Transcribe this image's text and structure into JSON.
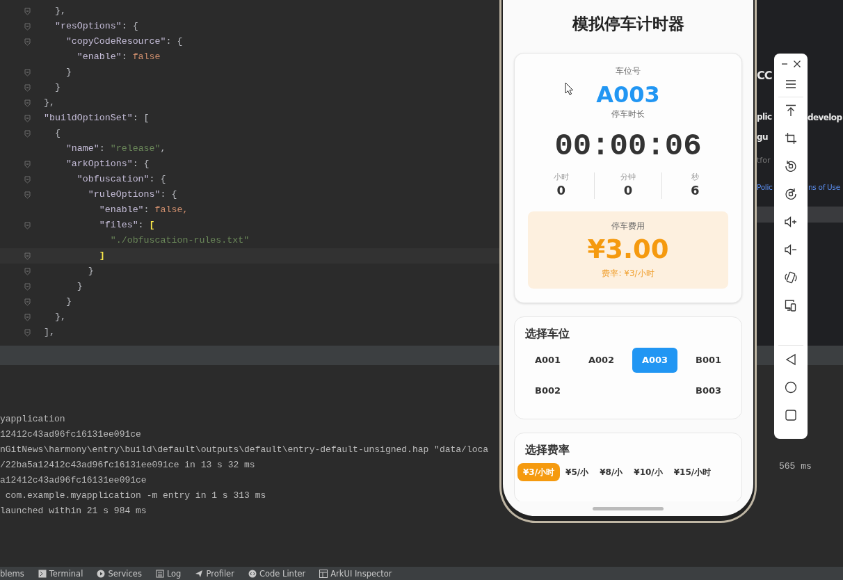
{
  "editor": {
    "lines": [
      {
        "fold": true,
        "current": false,
        "tokens": [
          {
            "kind": "punct",
            "text": "    },"
          }
        ]
      },
      {
        "fold": true,
        "current": false,
        "tokens": [
          {
            "kind": "key",
            "text": "    \"resOptions\""
          },
          {
            "kind": "punct",
            "text": ": {"
          }
        ]
      },
      {
        "fold": true,
        "current": false,
        "tokens": [
          {
            "kind": "key",
            "text": "      \"copyCodeResource\""
          },
          {
            "kind": "punct",
            "text": ": {"
          }
        ]
      },
      {
        "fold": false,
        "current": false,
        "tokens": [
          {
            "kind": "key",
            "text": "        \"enable\""
          },
          {
            "kind": "punct",
            "text": ": "
          },
          {
            "kind": "bool",
            "text": "false"
          }
        ]
      },
      {
        "fold": true,
        "current": false,
        "tokens": [
          {
            "kind": "punct",
            "text": "      }"
          }
        ]
      },
      {
        "fold": true,
        "current": false,
        "tokens": [
          {
            "kind": "punct",
            "text": "    }"
          }
        ]
      },
      {
        "fold": true,
        "current": false,
        "tokens": [
          {
            "kind": "punct",
            "text": "  },"
          }
        ]
      },
      {
        "fold": true,
        "current": false,
        "tokens": [
          {
            "kind": "key",
            "text": "  \"buildOptionSet\""
          },
          {
            "kind": "punct",
            "text": ": ["
          }
        ]
      },
      {
        "fold": true,
        "current": false,
        "tokens": [
          {
            "kind": "punct",
            "text": "    {"
          }
        ]
      },
      {
        "fold": false,
        "current": false,
        "tokens": [
          {
            "kind": "key",
            "text": "      \"name\""
          },
          {
            "kind": "punct",
            "text": ": "
          },
          {
            "kind": "string",
            "text": "\"release\""
          },
          {
            "kind": "punct",
            "text": ","
          }
        ]
      },
      {
        "fold": true,
        "current": false,
        "tokens": [
          {
            "kind": "key",
            "text": "      \"arkOptions\""
          },
          {
            "kind": "punct",
            "text": ": {"
          }
        ]
      },
      {
        "fold": true,
        "current": false,
        "tokens": [
          {
            "kind": "key",
            "text": "        \"obfuscation\""
          },
          {
            "kind": "punct",
            "text": ": {"
          }
        ]
      },
      {
        "fold": true,
        "current": false,
        "tokens": [
          {
            "kind": "key",
            "text": "          \"ruleOptions\""
          },
          {
            "kind": "punct",
            "text": ": {"
          }
        ]
      },
      {
        "fold": false,
        "current": false,
        "tokens": [
          {
            "kind": "key",
            "text": "            \"enable\""
          },
          {
            "kind": "punct",
            "text": ": "
          },
          {
            "kind": "bool",
            "text": "false,"
          }
        ]
      },
      {
        "fold": true,
        "current": false,
        "tokens": [
          {
            "kind": "key",
            "text": "            \"files\""
          },
          {
            "kind": "punct",
            "text": ": "
          },
          {
            "kind": "match",
            "text": "["
          }
        ]
      },
      {
        "fold": false,
        "current": false,
        "tokens": [
          {
            "kind": "string",
            "text": "              \"./obfuscation-rules.txt\""
          }
        ]
      },
      {
        "fold": true,
        "current": true,
        "tokens": [
          {
            "kind": "match",
            "text": "            ]"
          }
        ]
      },
      {
        "fold": true,
        "current": false,
        "tokens": [
          {
            "kind": "punct",
            "text": "          }"
          }
        ]
      },
      {
        "fold": true,
        "current": false,
        "tokens": [
          {
            "kind": "punct",
            "text": "        }"
          }
        ]
      },
      {
        "fold": true,
        "current": false,
        "tokens": [
          {
            "kind": "punct",
            "text": "      }"
          }
        ]
      },
      {
        "fold": true,
        "current": false,
        "tokens": [
          {
            "kind": "punct",
            "text": "    },"
          }
        ]
      },
      {
        "fold": true,
        "current": false,
        "tokens": [
          {
            "kind": "punct",
            "text": "  ],"
          }
        ]
      }
    ]
  },
  "console": {
    "lines": [
      "yapplication",
      "12412c43ad96fc16131ee091ce",
      "nGitNews\\harmony\\entry\\build\\default\\outputs\\default\\entry-default-unsigned.hap \"data/loca",
      "/22ba5a12412c43ad96fc16131ee091ce in 13 s 32 ms",
      "a12412c43ad96fc16131ee091ce",
      " com.example.myapplication -m entry in 1 s 313 ms",
      "launched within 21 s 984 ms"
    ],
    "tail": "565 ms"
  },
  "tool_tabs": [
    {
      "label": "blems"
    },
    {
      "label": "Terminal"
    },
    {
      "label": "Services"
    },
    {
      "label": "Log"
    },
    {
      "label": "Profiler"
    },
    {
      "label": "Code Linter"
    },
    {
      "label": "ArkUI Inspector"
    }
  ],
  "background_page": {
    "fragments": [
      {
        "kind": "heading",
        "text": "CC"
      },
      {
        "kind": "bold",
        "text": "plic"
      },
      {
        "kind": "bold",
        "text": "develop"
      },
      {
        "kind": "bold",
        "text": "gu"
      },
      {
        "kind": "muted",
        "text": "tfor"
      },
      {
        "kind": "link",
        "text": "Polic"
      },
      {
        "kind": "link",
        "text": "ns of Use"
      }
    ]
  },
  "app": {
    "title": "模拟停车计时器",
    "status": {
      "space_label": "车位号",
      "space": "A003",
      "duration_label": "停车时长",
      "duration": "00:00:06",
      "parts": [
        {
          "label": "小时",
          "value": "0"
        },
        {
          "label": "分钟",
          "value": "0"
        },
        {
          "label": "秒",
          "value": "6"
        }
      ],
      "fee_label": "停车费用",
      "fee": "¥3.00",
      "rate": "费率: ¥3/小时"
    },
    "space_picker": {
      "title": "选择车位",
      "rows": [
        [
          {
            "label": "A001",
            "selected": false
          },
          {
            "label": "A002",
            "selected": false
          },
          {
            "label": "A003",
            "selected": true
          },
          {
            "label": "B001",
            "selected": false
          }
        ],
        [
          {
            "label": "B002",
            "selected": false
          },
          "",
          "",
          {
            "label": "B003",
            "selected": false
          }
        ]
      ]
    },
    "rate_picker": {
      "title": "选择费率",
      "rates": [
        {
          "label": "¥3/小时",
          "selected": true
        },
        {
          "label": "¥5/小",
          "selected": false
        },
        {
          "label": "¥8/小",
          "selected": false
        },
        {
          "label": "¥10/小",
          "selected": false
        },
        {
          "label": "¥15/小时",
          "selected": false
        }
      ]
    }
  }
}
